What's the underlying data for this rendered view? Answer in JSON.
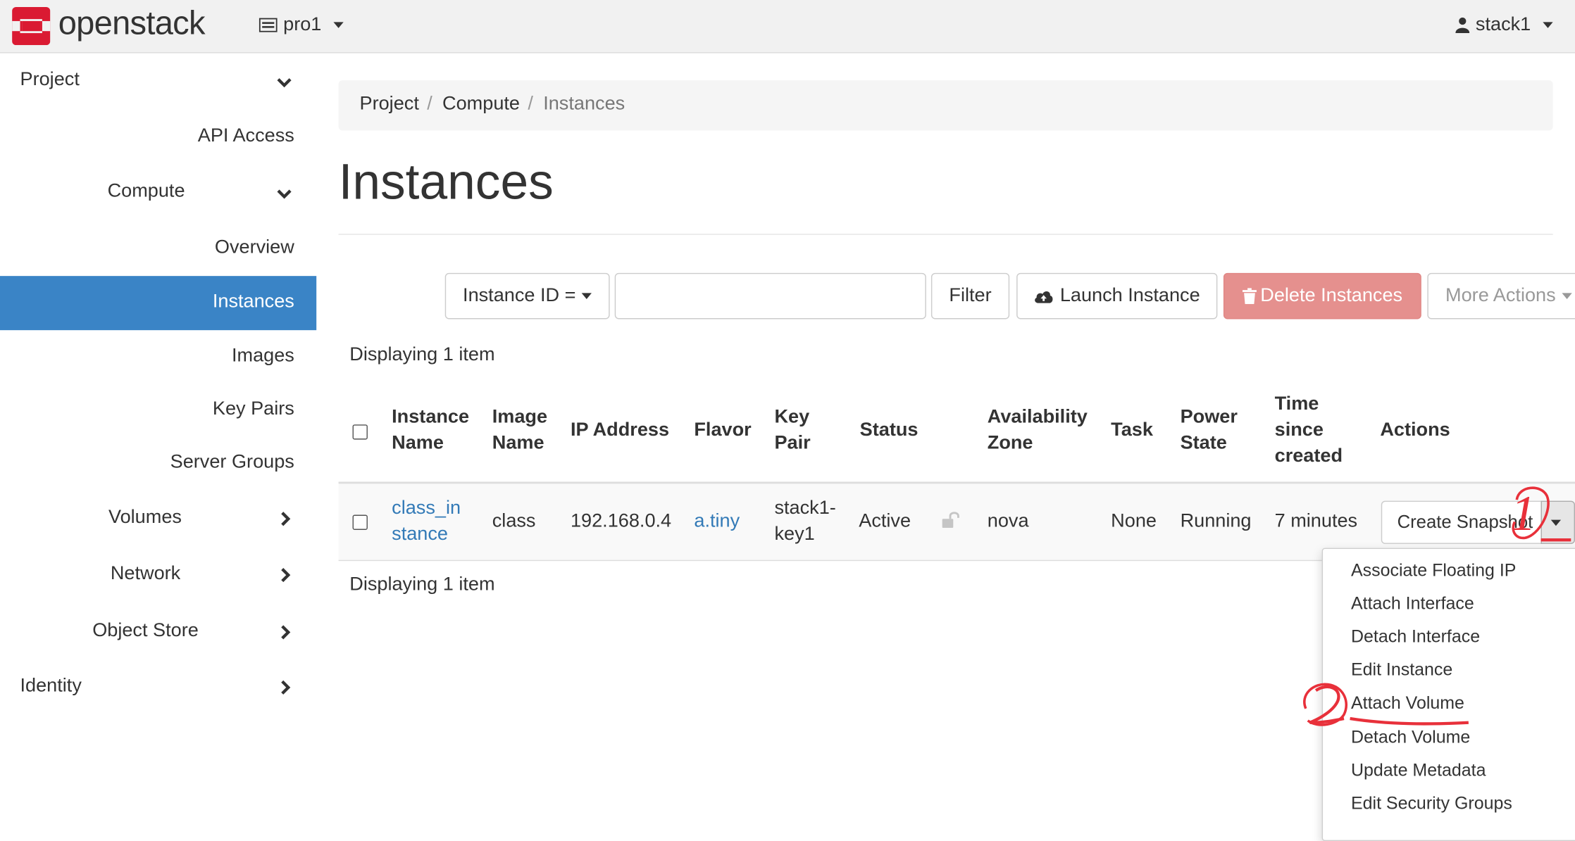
{
  "header": {
    "brand": "openstack",
    "project": "pro1",
    "user": "stack1"
  },
  "sidebar": {
    "project": "Project",
    "api_access": "API Access",
    "compute": "Compute",
    "overview": "Overview",
    "instances": "Instances",
    "images": "Images",
    "key_pairs": "Key Pairs",
    "server_groups": "Server Groups",
    "volumes": "Volumes",
    "network": "Network",
    "object_store": "Object Store",
    "identity": "Identity"
  },
  "breadcrumb": [
    "Project",
    "Compute",
    "Instances"
  ],
  "page_title": "Instances",
  "toolbar": {
    "filter_field": "Instance ID =",
    "filter_value": "",
    "filter_button": "Filter",
    "launch": "Launch Instance",
    "delete": "Delete Instances",
    "more": "More Actions"
  },
  "display_count": "Displaying 1 item",
  "table": {
    "headers": {
      "instance_name": [
        "Instance",
        "Name"
      ],
      "image_name": [
        "Image",
        "Name"
      ],
      "ip_address": "IP Address",
      "flavor": "Flavor",
      "key_pair": [
        "Key",
        "Pair"
      ],
      "status": "Status",
      "availability_zone": [
        "Availability",
        "Zone"
      ],
      "task": "Task",
      "power_state": [
        "Power",
        "State"
      ],
      "time_since_created": [
        "Time",
        "since",
        "created"
      ],
      "actions": "Actions"
    },
    "rows": [
      {
        "instance_name": [
          "class_in",
          "stance"
        ],
        "image_name": "class",
        "ip_address": "192.168.0.4",
        "flavor": "a.tiny",
        "key_pair": [
          "stack1-",
          "key1"
        ],
        "status": "Active",
        "availability_zone": "nova",
        "task": "None",
        "power_state": "Running",
        "time_since_created": "7 minutes",
        "action_button": "Create Snapshot"
      }
    ]
  },
  "dropdown": [
    "Associate Floating IP",
    "Attach Interface",
    "Detach Interface",
    "Edit Instance",
    "Attach Volume",
    "Detach Volume",
    "Update Metadata",
    "Edit Security Groups"
  ],
  "annotations": [
    "1",
    "2"
  ],
  "colors": {
    "active": "#3a84c6",
    "danger": "#e5908e",
    "link": "#337ab7",
    "annotation": "#e8303a",
    "brand": "#da1a32"
  }
}
